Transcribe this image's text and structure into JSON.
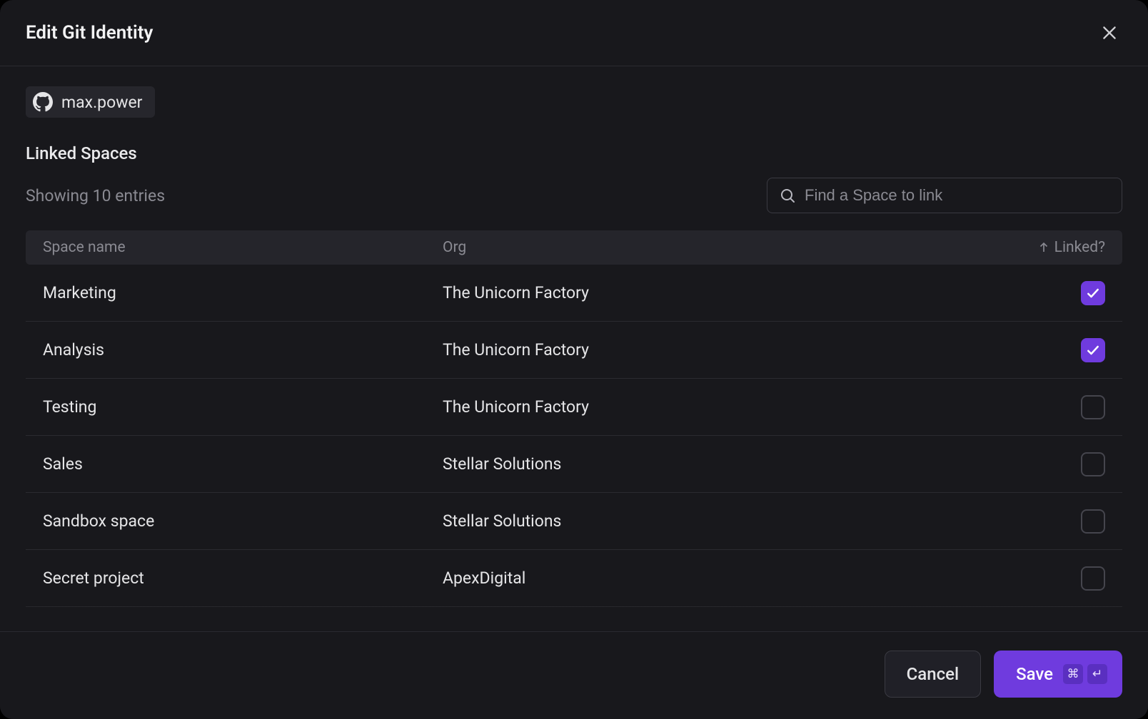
{
  "modal": {
    "title": "Edit Git Identity"
  },
  "identity": {
    "provider_icon": "github-icon",
    "username": "max.power"
  },
  "section": {
    "title": "Linked Spaces",
    "entries_label": "Showing 10 entries"
  },
  "search": {
    "placeholder": "Find a Space to link",
    "value": ""
  },
  "table": {
    "columns": {
      "space": "Space name",
      "org": "Org",
      "linked": "Linked?"
    },
    "sort": {
      "column": "linked",
      "direction": "asc"
    },
    "rows": [
      {
        "space": "Marketing",
        "org": "The Unicorn Factory",
        "linked": true
      },
      {
        "space": "Analysis",
        "org": "The Unicorn Factory",
        "linked": true
      },
      {
        "space": "Testing",
        "org": "The Unicorn Factory",
        "linked": false
      },
      {
        "space": "Sales",
        "org": "Stellar Solutions",
        "linked": false
      },
      {
        "space": "Sandbox space",
        "org": "Stellar Solutions",
        "linked": false
      },
      {
        "space": "Secret project",
        "org": "ApexDigital",
        "linked": false
      }
    ]
  },
  "footer": {
    "cancel": "Cancel",
    "save": "Save",
    "shortcut": [
      "⌘",
      "↵"
    ]
  }
}
